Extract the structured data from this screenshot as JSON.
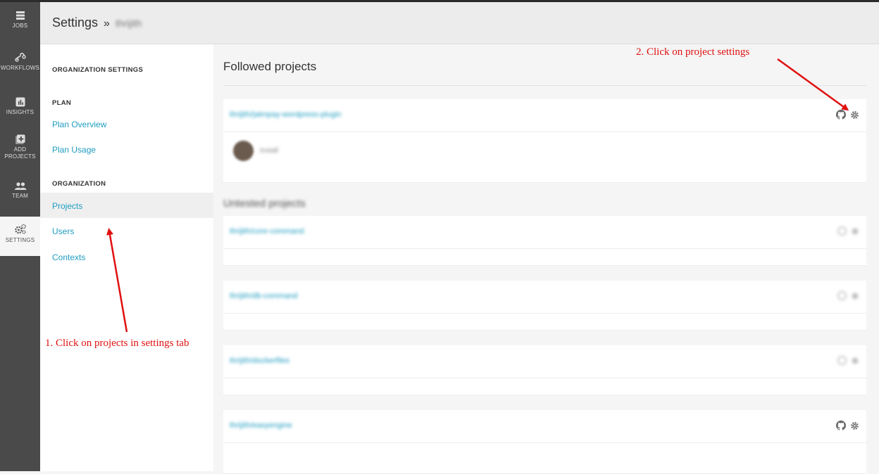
{
  "nav": {
    "items": [
      {
        "label": "JOBS",
        "icon": "jobs-icon"
      },
      {
        "label": "WORKFLOWS",
        "icon": "workflows-icon"
      },
      {
        "label": "INSIGHTS",
        "icon": "insights-icon"
      },
      {
        "label": "ADD PROJECTS",
        "icon": "add-projects-icon"
      },
      {
        "label": "TEAM",
        "icon": "team-icon"
      },
      {
        "label": "SETTINGS",
        "icon": "settings-icon"
      }
    ]
  },
  "header": {
    "title": "Settings",
    "separator": "»",
    "org": "thrijith"
  },
  "sidebar": {
    "org_settings_heading": "ORGANIZATION SETTINGS",
    "plan_heading": "PLAN",
    "plan_overview": "Plan Overview",
    "plan_usage": "Plan Usage",
    "organization_heading": "ORGANIZATION",
    "projects": "Projects",
    "users": "Users",
    "contexts": "Contexts"
  },
  "main": {
    "followed_heading": "Followed projects",
    "followed": [
      {
        "name": "thrijith/|atmpay-wordpress-plugin",
        "user": "Install"
      }
    ],
    "untested_heading": "Untested projects",
    "untested": [
      {
        "name": "thrijith/core-command"
      },
      {
        "name": "thrijith/db-command"
      },
      {
        "name": "thrijith/dockerfiles"
      },
      {
        "name": "thrijith/easyengine"
      }
    ]
  },
  "annotations": {
    "step1": "1. Click on projects in settings tab",
    "step2": "2. Click on project settings",
    "color": "#e01010"
  },
  "colors": {
    "link": "#1e9dc0",
    "nav_bg": "#4a4a4a"
  }
}
